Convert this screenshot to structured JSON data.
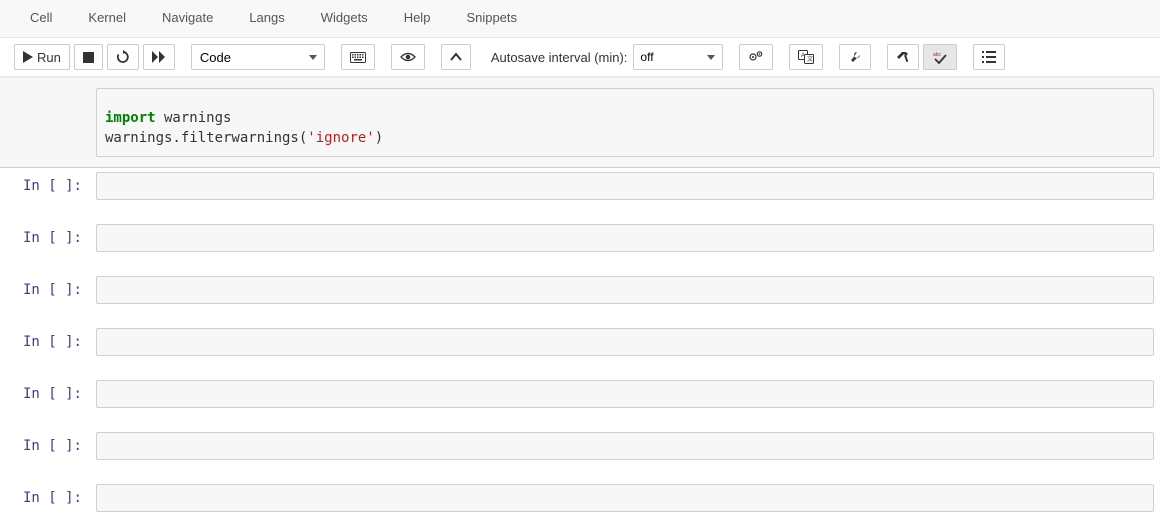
{
  "menu": {
    "items": [
      "Cell",
      "Kernel",
      "Navigate",
      "Langs",
      "Widgets",
      "Help",
      "Snippets"
    ]
  },
  "toolbar": {
    "run_label": "Run",
    "cell_type_selected": "Code",
    "autosave_label": "Autosave interval (min):",
    "autosave_selected": "off"
  },
  "cells": [
    {
      "prompt": "",
      "code_tokens": [
        {
          "t": "import",
          "cls": "kw"
        },
        {
          "t": " warnings\n",
          "cls": ""
        },
        {
          "t": "warnings.filterwarnings(",
          "cls": ""
        },
        {
          "t": "'ignore'",
          "cls": "str"
        },
        {
          "t": ")",
          "cls": ""
        }
      ]
    },
    {
      "prompt": "In [ ]:",
      "code": ""
    },
    {
      "prompt": "In [ ]:",
      "code": ""
    },
    {
      "prompt": "In [ ]:",
      "code": ""
    },
    {
      "prompt": "In [ ]:",
      "code": ""
    },
    {
      "prompt": "In [ ]:",
      "code": ""
    },
    {
      "prompt": "In [ ]:",
      "code": ""
    },
    {
      "prompt": "In [ ]:",
      "code": ""
    }
  ]
}
